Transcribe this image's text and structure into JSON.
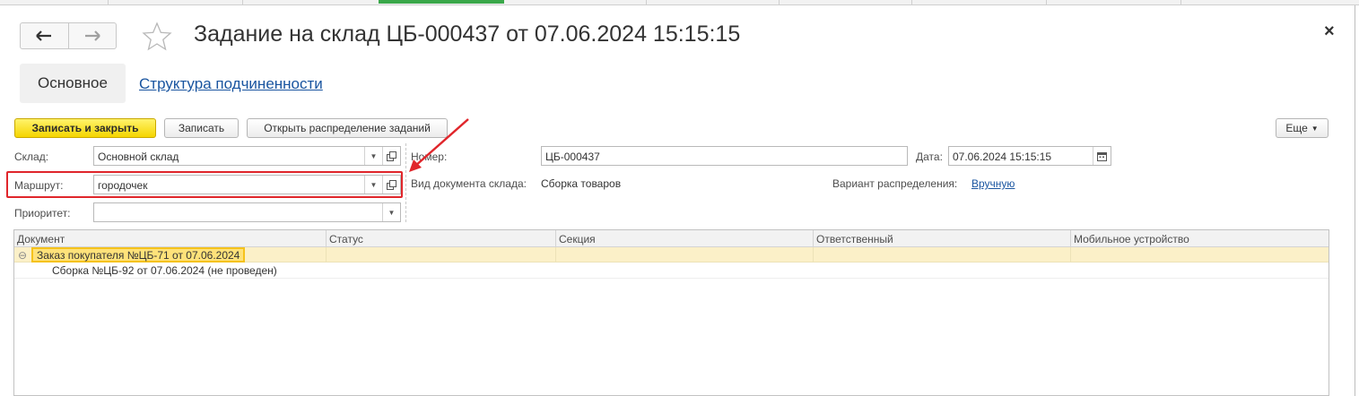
{
  "window": {
    "title": "Задание на склад ЦБ-000437 от 07.06.2024 15:15:15",
    "close_symbol": "×"
  },
  "nav": {
    "back_icon": "arrow-left-icon",
    "forward_icon": "arrow-right-icon",
    "back_glyph": "🡐",
    "forward_glyph": "🡒"
  },
  "tabs": {
    "main": "Основное",
    "structure": "Структура подчиненности"
  },
  "toolbar": {
    "save_close": "Записать и закрыть",
    "save": "Записать",
    "open_distribution": "Открыть распределение заданий",
    "more": "Еще"
  },
  "form": {
    "warehouse": {
      "label": "Склад:",
      "value": "Основной склад"
    },
    "route": {
      "label": "Маршрут:",
      "value": "городочек"
    },
    "priority": {
      "label": "Приоритет:",
      "value": ""
    },
    "number": {
      "label": "Номер:",
      "value": "ЦБ-000437"
    },
    "date": {
      "label": "Дата:",
      "value": "07.06.2024 15:15:15"
    },
    "doc_type": {
      "label": "Вид документа склада:",
      "value": "Сборка товаров"
    },
    "distribution": {
      "label": "Вариант распределения:",
      "value": "Вручную"
    }
  },
  "table": {
    "columns": [
      "Документ",
      "Статус",
      "Секция",
      "Ответственный",
      "Мобильное устройство"
    ],
    "rows": [
      {
        "document": "Заказ покупателя №ЦБ-71 от 07.06.2024",
        "selected": true,
        "expanded": true
      },
      {
        "document": "Сборка №ЦБ-92 от 07.06.2024 (не проведен)",
        "child": true
      }
    ]
  },
  "colors": {
    "accent_yellow": "#f5d500",
    "link_blue": "#1a55a0",
    "highlight_red": "#e0262b",
    "row_selected": "#fbf0c8",
    "active_tab_green": "#3aa84a"
  }
}
